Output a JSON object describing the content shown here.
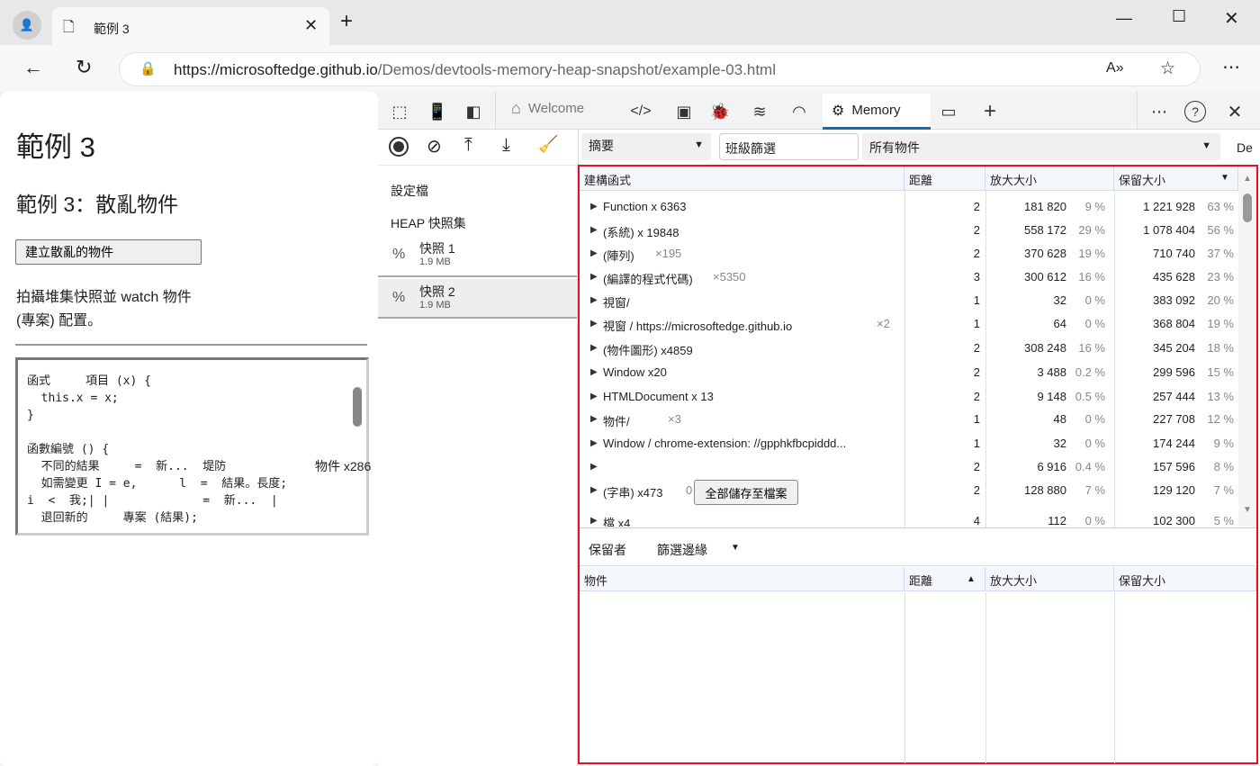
{
  "browser": {
    "tab_title": "範例 3",
    "url_host": "https://microsoftedge.github.io",
    "url_path": "/Demos/devtools-memory-heap-snapshot/example-03.html"
  },
  "page": {
    "h1": "範例 3",
    "h2": "範例 3：散亂物件",
    "button": "建立散亂的物件",
    "desc1": "拍攝堆集快照並 watch 物件",
    "desc2": "(專案) 配置。",
    "code": [
      "函式　　　項目 (x) {",
      "  this.x = x;",
      "}",
      "",
      "函數編號 () {",
      "  不同的結果　　　=  新...  堤防",
      "  如需變更 I = e,　　　 l  =  結果。長度;",
      "i  <  我;| |　　　　　　　　=  新...  |",
      "  退回新的　　　專案 (結果);"
    ],
    "overlay": "物件 x286"
  },
  "devtools": {
    "tabs": {
      "welcome": "Welcome",
      "memory": "Memory"
    },
    "toolbar2": {
      "view": "摘要",
      "class_filter": "班級篩選",
      "objects": "所有物件",
      "trailing": "De"
    },
    "sidebar": {
      "profiles": "設定檔",
      "heap_header": "HEAP 快照集",
      "snapshots": [
        {
          "name": "快照 1",
          "size": "1.9 MB"
        },
        {
          "name": "快照 2",
          "size": "1.9 MB"
        }
      ]
    },
    "table": {
      "headers": [
        "建構函式",
        "距離",
        "放大大小",
        "保留大小"
      ],
      "rows": [
        {
          "name": "Function x 6363",
          "count": "",
          "dist": "2",
          "shallow": "181 820",
          "sp": "9 %",
          "retained": "1 221 928",
          "rp": "63 %"
        },
        {
          "name": "(系統) x 19848",
          "count": "",
          "dist": "2",
          "shallow": "558 172",
          "sp": "29 %",
          "retained": "1 078 404",
          "rp": "56 %"
        },
        {
          "name": "(陣列)",
          "count": "×195",
          "dist": "2",
          "shallow": "370 628",
          "sp": "19 %",
          "retained": "710 740",
          "rp": "37 %"
        },
        {
          "name": "(編譯的程式代碼)",
          "count": "×5350",
          "dist": "3",
          "shallow": "300 612",
          "sp": "16 %",
          "retained": "435 628",
          "rp": "23 %"
        },
        {
          "name": "視窗/",
          "count": "",
          "dist": "1",
          "shallow": "32",
          "sp": "0 %",
          "retained": "383 092",
          "rp": "20 %"
        },
        {
          "name": "視窗 / https://microsoftedge.github.io",
          "count": "×2",
          "dist": "1",
          "shallow": "64",
          "sp": "0 %",
          "retained": "368 804",
          "rp": "19 %"
        },
        {
          "name": "(物件圖形) x4859",
          "count": "",
          "dist": "2",
          "shallow": "308 248",
          "sp": "16 %",
          "retained": "345 204",
          "rp": "18 %"
        },
        {
          "name": "Window x20",
          "count": "",
          "dist": "2",
          "shallow": "3 488",
          "sp": "0.2 %",
          "retained": "299 596",
          "rp": "15 %"
        },
        {
          "name": "HTMLDocument x 13",
          "count": "",
          "dist": "2",
          "shallow": "9 148",
          "sp": "0.5 %",
          "retained": "257 444",
          "rp": "13 %"
        },
        {
          "name": "物件/",
          "count": "×3",
          "dist": "1",
          "shallow": "48",
          "sp": "0 %",
          "retained": "227 708",
          "rp": "12 %"
        },
        {
          "name": "Window  /  chrome-extension: //gpphkfbcpiddd...",
          "count": "",
          "dist": "1",
          "shallow": "32",
          "sp": "0 %",
          "retained": "174 244",
          "rp": "9 %"
        },
        {
          "name": "",
          "count": "",
          "dist": "2",
          "shallow": "6 916",
          "sp": "0.4 %",
          "retained": "157 596",
          "rp": "8 %"
        },
        {
          "name": "(字串) x473",
          "count": "0",
          "dist": "2",
          "shallow": "128 880",
          "sp": "7 %",
          "retained": "129 120",
          "rp": "7 %"
        },
        {
          "name": "檔 x4",
          "count": "",
          "dist": "4",
          "shallow": "112",
          "sp": "0 %",
          "retained": "102 300",
          "rp": "5 %"
        }
      ],
      "save_button": "全部儲存至檔案"
    },
    "retainers": {
      "tab": "保留者",
      "filter": "篩選邊緣",
      "headers": [
        "物件",
        "距離",
        "放大大小",
        "保留大小"
      ]
    }
  },
  "colors": {
    "accent": "#0f6cbd",
    "highlight": "#e81123"
  }
}
